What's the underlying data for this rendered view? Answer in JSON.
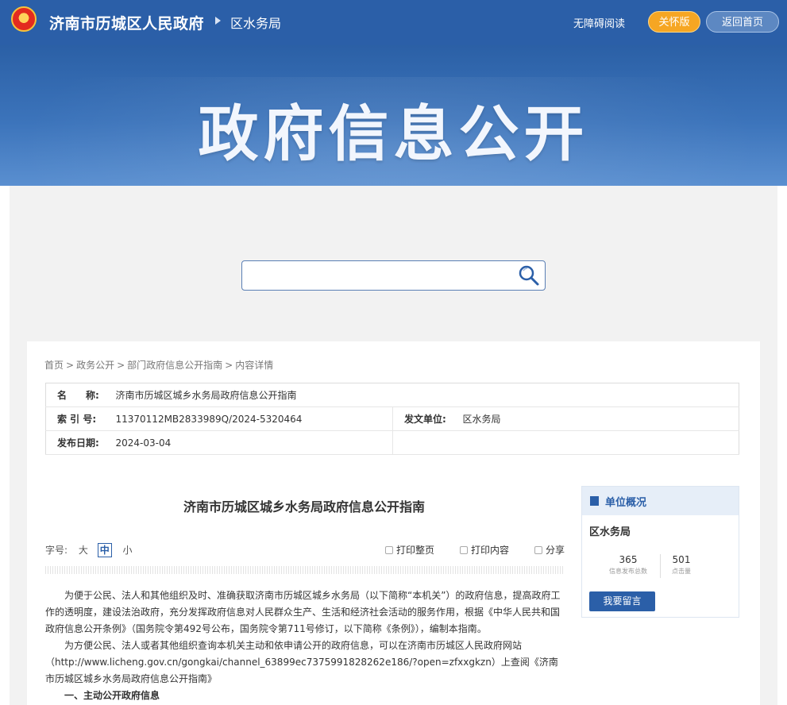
{
  "header": {
    "site_title": "济南市历城区人民政府",
    "dept": "区水务局",
    "accessibility": "无障碍阅读",
    "care_mode": "关怀版",
    "back_home": "返回首页"
  },
  "banner": {
    "title": "政府信息公开"
  },
  "search": {
    "placeholder": ""
  },
  "breadcrumb": [
    "首页",
    "政务公开",
    "部门政府信息公开指南",
    "内容详情"
  ],
  "meta": {
    "name_label": "名　　称:",
    "name_value": "济南市历城区城乡水务局政府信息公开指南",
    "index_label": "索 引 号:",
    "index_value": "11370112MB2833989Q/2024-5320464",
    "issuer_label": "发文单位:",
    "issuer_value": "区水务局",
    "date_label": "发布日期:",
    "date_value": "2024-03-04"
  },
  "article": {
    "title": "济南市历城区城乡水务局政府信息公开指南",
    "font_size_label": "字号:",
    "font_large": "大",
    "font_medium": "中",
    "font_small": "小",
    "print_page": "打印整页",
    "print_content": "打印内容",
    "share": "分享",
    "p1": "为便于公民、法人和其他组织及时、准确获取济南市历城区城乡水务局（以下简称“本机关”）的政府信息，提高政府工作的透明度，建设法治政府，充分发挥政府信息对人民群众生产、生活和经济社会活动的服务作用，根据《中华人民共和国政府信息公开条例》（国务院令第492号公布，国务院令第711号修订，以下简称《条例》），编制本指南。",
    "p2": "为方便公民、法人或者其他组织查询本机关主动和依申请公开的政府信息，可以在济南市历城区人民政府网站（http://www.licheng.gov.cn/gongkai/channel_63899ec7375991828262e186/?open=zfxxgkzn）上查阅《济南市历城区城乡水务局政府信息公开指南》",
    "h1": "一、主动公开政府信息"
  },
  "sidebar": {
    "title": "单位概况",
    "org": "区水务局",
    "stat1_value": "365",
    "stat1_label": "信息发布总数",
    "stat2_value": "501",
    "stat2_label": "点击量",
    "message_button": "我要留言"
  }
}
